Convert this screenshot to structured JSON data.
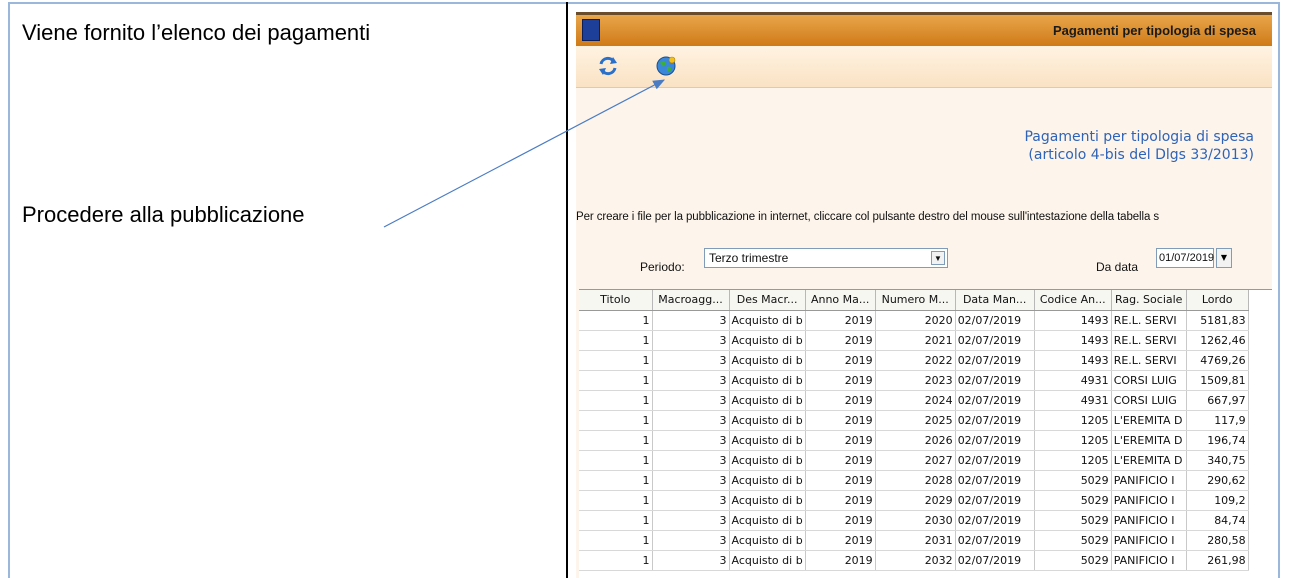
{
  "document": {
    "left_text_1": "Viene fornito l’elenco dei pagamenti",
    "left_text_2": "Procedere alla pubblicazione"
  },
  "app": {
    "window_title": "Pagamenti per tipologia di spesa",
    "toolbar": {
      "refresh_icon": "refresh-icon",
      "publish_icon": "globe-publish-icon"
    },
    "heading_line1": "Pagamenti per tipologia di spesa",
    "heading_line2": "(articolo 4-bis del Dlgs 33/2013)",
    "instructions": "Per creare i file per la pubblicazione in internet, cliccare col pulsante destro del mouse sull'intestazione della tabella s",
    "filters": {
      "periodo_label": "Periodo:",
      "periodo_value": "Terzo trimestre",
      "da_data_label": "Da data",
      "da_data_value": "01/07/2019"
    },
    "table": {
      "columns": [
        "Titolo",
        "Macroagg...",
        "Des Macr...",
        "Anno Ma...",
        "Numero M...",
        "Data Man...",
        "Codice An...",
        "Rag. Sociale",
        "Lordo"
      ],
      "rows": [
        [
          "1",
          "3",
          "Acquisto di b",
          "2019",
          "2020",
          "02/07/2019",
          "1493",
          "RE.L. SERVI",
          "5181,83"
        ],
        [
          "1",
          "3",
          "Acquisto di b",
          "2019",
          "2021",
          "02/07/2019",
          "1493",
          "RE.L. SERVI",
          "1262,46"
        ],
        [
          "1",
          "3",
          "Acquisto di b",
          "2019",
          "2022",
          "02/07/2019",
          "1493",
          "RE.L. SERVI",
          "4769,26"
        ],
        [
          "1",
          "3",
          "Acquisto di b",
          "2019",
          "2023",
          "02/07/2019",
          "4931",
          "CORSI LUIG",
          "1509,81"
        ],
        [
          "1",
          "3",
          "Acquisto di b",
          "2019",
          "2024",
          "02/07/2019",
          "4931",
          "CORSI LUIG",
          "667,97"
        ],
        [
          "1",
          "3",
          "Acquisto di b",
          "2019",
          "2025",
          "02/07/2019",
          "1205",
          "L'EREMITA D",
          "117,9"
        ],
        [
          "1",
          "3",
          "Acquisto di b",
          "2019",
          "2026",
          "02/07/2019",
          "1205",
          "L'EREMITA D",
          "196,74"
        ],
        [
          "1",
          "3",
          "Acquisto di b",
          "2019",
          "2027",
          "02/07/2019",
          "1205",
          "L'EREMITA D",
          "340,75"
        ],
        [
          "1",
          "3",
          "Acquisto di b",
          "2019",
          "2028",
          "02/07/2019",
          "5029",
          "PANIFICIO I",
          "290,62"
        ],
        [
          "1",
          "3",
          "Acquisto di b",
          "2019",
          "2029",
          "02/07/2019",
          "5029",
          "PANIFICIO I",
          "109,2"
        ],
        [
          "1",
          "3",
          "Acquisto di b",
          "2019",
          "2030",
          "02/07/2019",
          "5029",
          "PANIFICIO I",
          "84,74"
        ],
        [
          "1",
          "3",
          "Acquisto di b",
          "2019",
          "2031",
          "02/07/2019",
          "5029",
          "PANIFICIO I",
          "280,58"
        ],
        [
          "1",
          "3",
          "Acquisto di b",
          "2019",
          "2032",
          "02/07/2019",
          "5029",
          "PANIFICIO I",
          "261,98"
        ]
      ]
    }
  },
  "colors": {
    "titlebar": "#d98a28",
    "heading_blue": "#2f63b7",
    "frame_blue": "#9bb7db"
  }
}
